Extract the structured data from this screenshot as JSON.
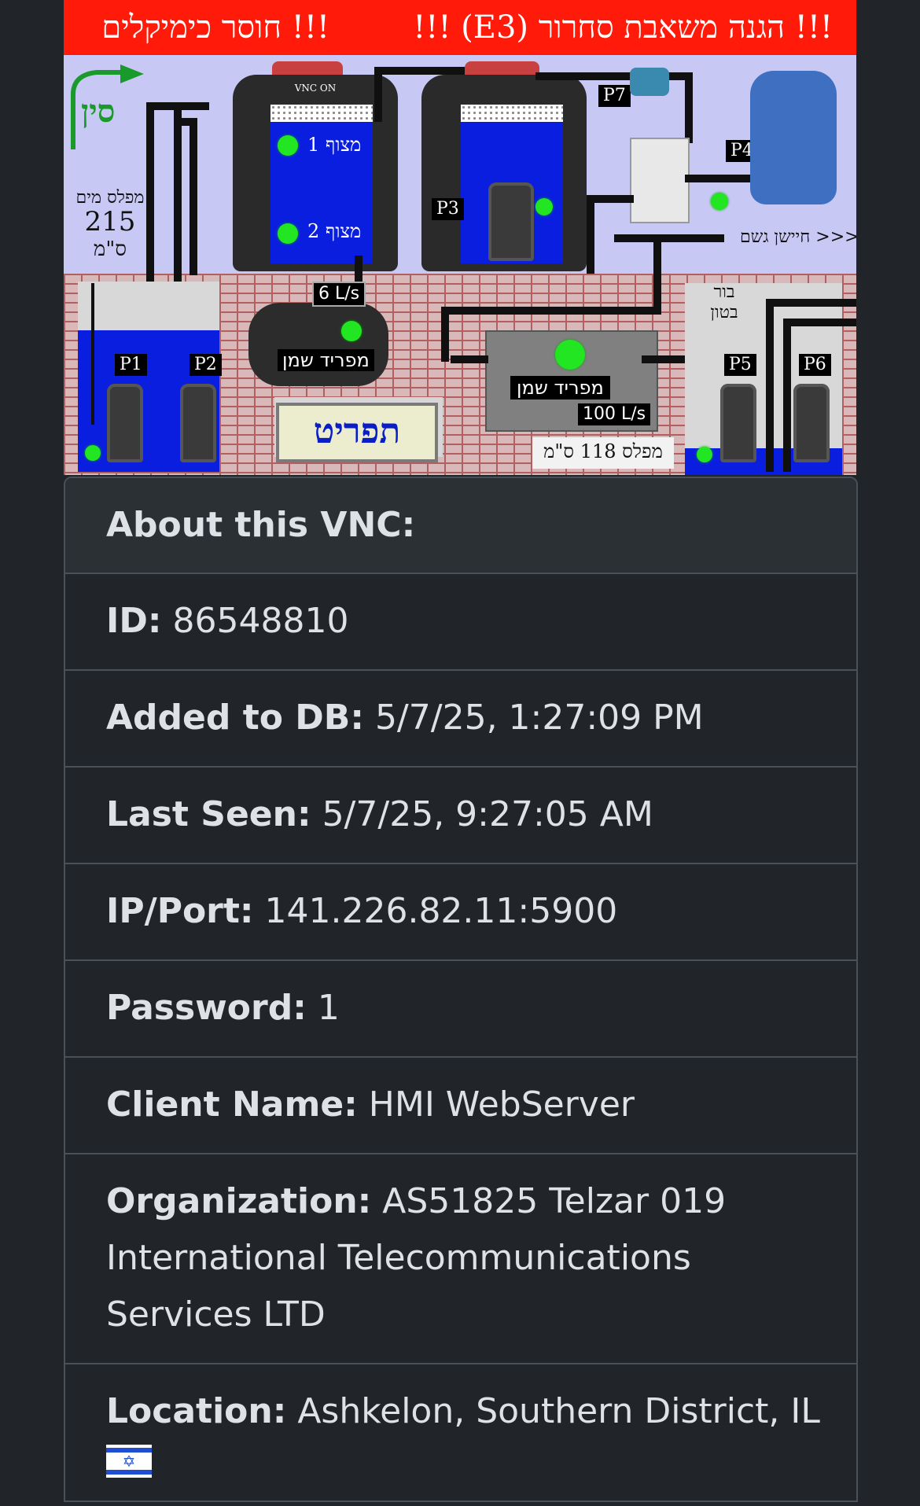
{
  "hmi": {
    "banner_left": "!!! חוסר כימיקלים",
    "banner_right": "!!! הגנה משאבת סחרור (E3) !!!",
    "tank_brand": "VNC ON",
    "float_1": "מצוף 1",
    "float_2": "מצוף 2",
    "pump_tags": [
      "P1",
      "P2",
      "P3",
      "P4",
      "P5",
      "P6",
      "P7"
    ],
    "water_level_label": "מפלס מים",
    "water_level_value": "215",
    "water_level_unit": "ס\"מ",
    "rain_sensor": "<<< חיישן גשם",
    "separator_small_flow": "6 L/s",
    "separator_small_label": "מפריד שמן",
    "separator_big_label": "מפריד שמן",
    "separator_big_flow": "100 L/s",
    "concrete_pit_line1": "בור",
    "concrete_pit_line2": "בטון",
    "level_bottom": "מפלס 118 ס\"מ",
    "menu_button": "תפריט"
  },
  "card": {
    "header": "About this VNC:",
    "fields": [
      {
        "label": "ID:",
        "value": "86548810"
      },
      {
        "label": "Added to DB:",
        "value": "5/7/25, 1:27:09 PM"
      },
      {
        "label": "Last Seen:",
        "value": "5/7/25, 9:27:05 AM"
      },
      {
        "label": "IP/Port:",
        "value": "141.226.82.11:5900"
      },
      {
        "label": "Password:",
        "value": "1"
      },
      {
        "label": "Client Name:",
        "value": "HMI WebServer"
      },
      {
        "label": "Organization:",
        "value": "AS51825 Telzar 019 International Telecommunications Services LTD"
      },
      {
        "label": "Location:",
        "value": "Ashkelon, Southern District, IL"
      }
    ],
    "flag_icon": "israel-flag-icon"
  },
  "colors": {
    "page_bg": "#212529",
    "banner_red": "#ff1a0a",
    "water_blue": "#0a1ee0",
    "led_green": "#22e622",
    "border": "#495057"
  }
}
